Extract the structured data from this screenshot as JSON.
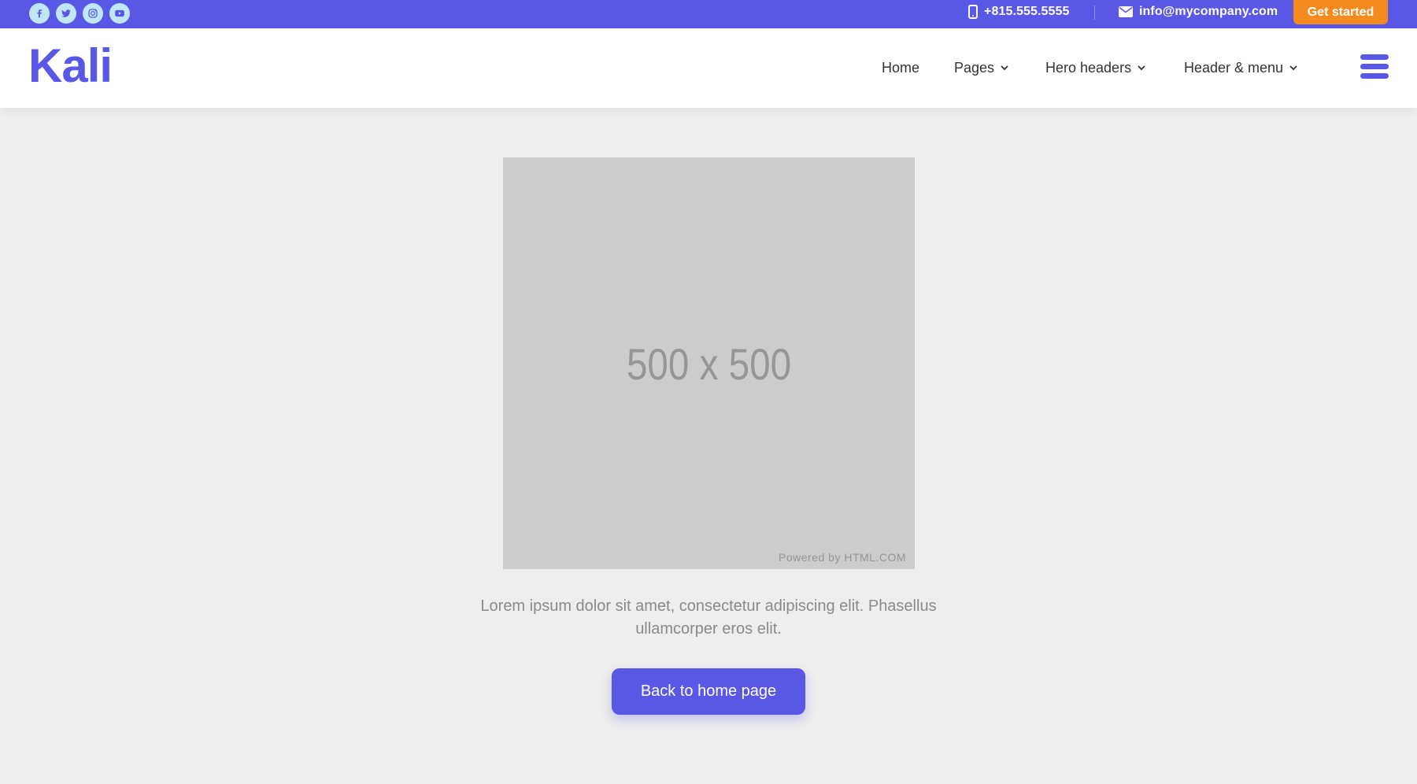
{
  "topbar": {
    "social": [
      {
        "icon": "facebook-icon"
      },
      {
        "icon": "twitter-icon"
      },
      {
        "icon": "instagram-icon"
      },
      {
        "icon": "youtube-icon"
      }
    ],
    "phone": "+815.555.5555",
    "email": "info@mycompany.com",
    "cta_label": "Get started",
    "colors": {
      "bar": "#5957e6",
      "cta": "#f58a1f",
      "social_bg": "#bfe7f7"
    }
  },
  "header": {
    "logo": "Kali",
    "nav": [
      {
        "label": "Home",
        "has_dropdown": false
      },
      {
        "label": "Pages",
        "has_dropdown": true
      },
      {
        "label": "Hero headers",
        "has_dropdown": true
      },
      {
        "label": "Header & menu",
        "has_dropdown": true
      }
    ],
    "menu_icon": "hamburger-menu-icon"
  },
  "main": {
    "placeholder": {
      "size_text": "500 x 500",
      "credit": "Powered by HTML.COM"
    },
    "description": "Lorem ipsum dolor sit amet, consectetur adipiscing elit. Phasellus ullamcorper eros elit.",
    "back_button": "Back to home page"
  }
}
